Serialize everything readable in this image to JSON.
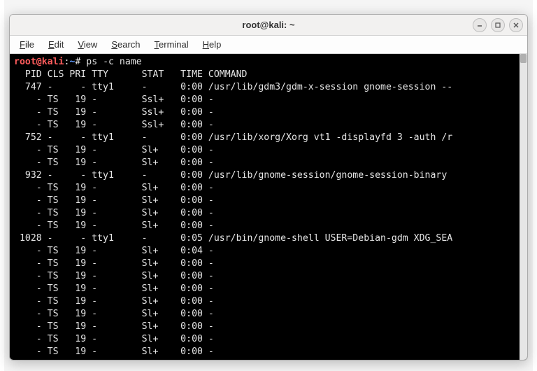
{
  "window": {
    "title": "root@kali: ~"
  },
  "menu": {
    "items": [
      "File",
      "Edit",
      "View",
      "Search",
      "Terminal",
      "Help"
    ]
  },
  "prompt": {
    "user_host": "root@kali",
    "sep": ":",
    "path": "~",
    "char": "# ",
    "command": "ps -c name"
  },
  "ps": {
    "header": "  PID CLS PRI TTY      STAT   TIME COMMAND",
    "rows": [
      "  747 -     - tty1     -      0:00 /usr/lib/gdm3/gdm-x-session gnome-session --",
      "    - TS   19 -        Ssl+   0:00 -",
      "    - TS   19 -        Ssl+   0:00 -",
      "    - TS   19 -        Ssl+   0:00 -",
      "  752 -     - tty1     -      0:00 /usr/lib/xorg/Xorg vt1 -displayfd 3 -auth /r",
      "    - TS   19 -        Sl+    0:00 -",
      "    - TS   19 -        Sl+    0:00 -",
      "  932 -     - tty1     -      0:00 /usr/lib/gnome-session/gnome-session-binary ",
      "    - TS   19 -        Sl+    0:00 -",
      "    - TS   19 -        Sl+    0:00 -",
      "    - TS   19 -        Sl+    0:00 -",
      "    - TS   19 -        Sl+    0:00 -",
      " 1028 -     - tty1     -      0:05 /usr/bin/gnome-shell USER=Debian-gdm XDG_SEA",
      "    - TS   19 -        Sl+    0:04 -",
      "    - TS   19 -        Sl+    0:00 -",
      "    - TS   19 -        Sl+    0:00 -",
      "    - TS   19 -        Sl+    0:00 -",
      "    - TS   19 -        Sl+    0:00 -",
      "    - TS   19 -        Sl+    0:00 -",
      "    - TS   19 -        Sl+    0:00 -",
      "    - TS   19 -        Sl+    0:00 -",
      "    - TS   19 -        Sl+    0:00 -"
    ]
  }
}
